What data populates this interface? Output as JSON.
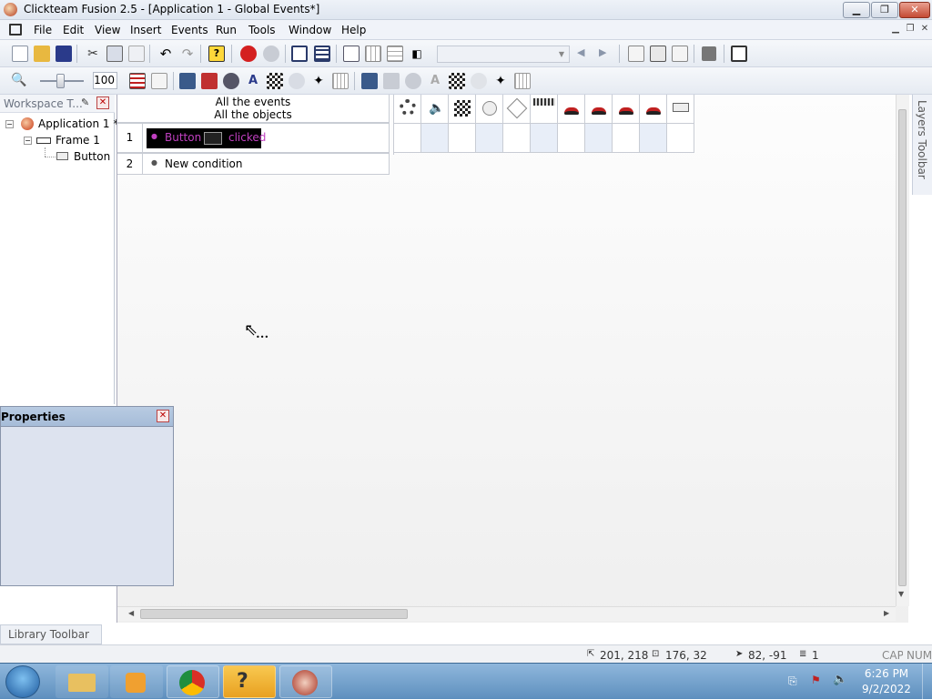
{
  "window": {
    "title": "Clickteam Fusion 2.5 - [Application 1 - Global Events*]"
  },
  "menu": [
    "File",
    "Edit",
    "View",
    "Insert",
    "Events",
    "Run",
    "Tools",
    "Window",
    "Help"
  ],
  "toolbar2": {
    "zoom_value": "100"
  },
  "workspace": {
    "title": "Workspace T...",
    "tree": [
      {
        "label": "Application 1 *",
        "level": 0
      },
      {
        "label": "Frame 1",
        "level": 1
      },
      {
        "label": "Button",
        "level": 2
      }
    ]
  },
  "events": {
    "header_line1": "All the events",
    "header_line2": "All the objects",
    "rows": [
      {
        "number": "1",
        "object": "Button",
        "condition": "clicked"
      },
      {
        "number": "2",
        "new_condition": "New condition"
      }
    ]
  },
  "properties": {
    "title": "Properties"
  },
  "layers_toolbar": {
    "label": "Layers Toolbar"
  },
  "library_toolbar": {
    "label": "Library Toolbar"
  },
  "status": {
    "pos": "201, 218",
    "size": "176, 32",
    "mouse": "82, -91",
    "layer": "1",
    "caps": "CAP",
    "num": "NUM"
  },
  "taskbar": {
    "time": "6:26 PM",
    "date": "9/2/2022"
  },
  "colors": {
    "titlebar": "#e6ecf4",
    "event_highlight": "#000000",
    "event_text": "#c040c0"
  }
}
